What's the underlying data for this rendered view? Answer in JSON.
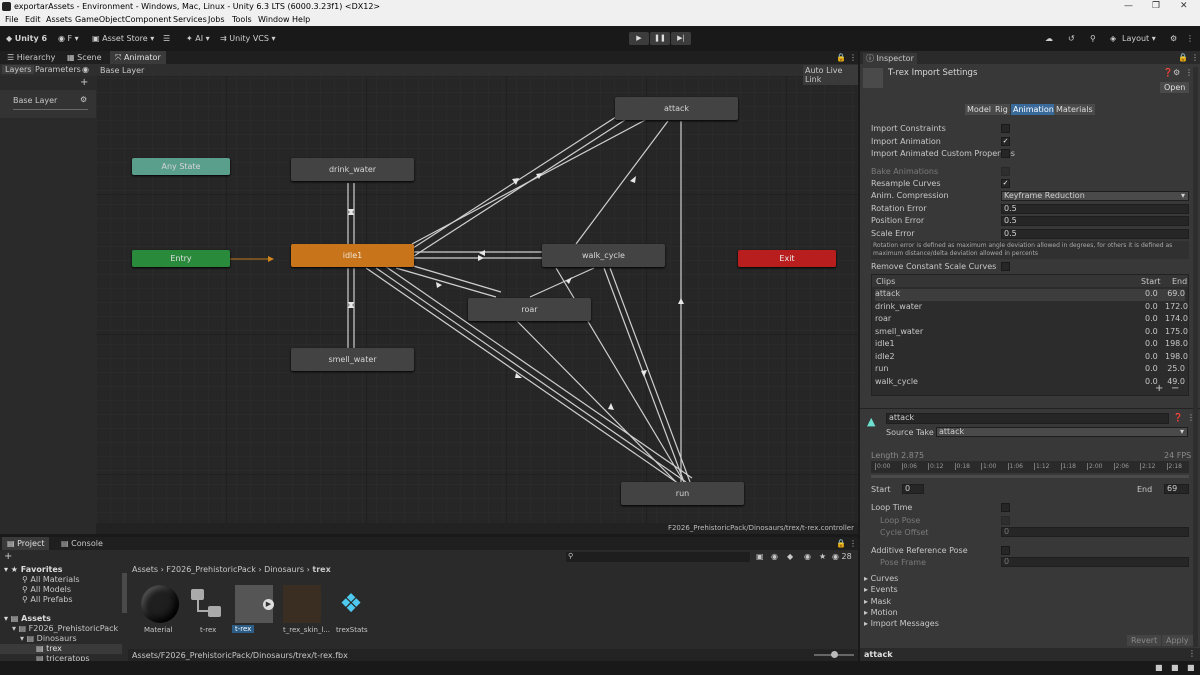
{
  "window": {
    "title": "exportarAssets - Environment - Windows, Mac, Linux - Unity 6.3 LTS (6000.3.23f1) <DX12>"
  },
  "menu": [
    "File",
    "Edit",
    "Assets",
    "GameObject",
    "Component",
    "Services",
    "Jobs",
    "Tools",
    "Window",
    "Help"
  ],
  "toolbar": {
    "unity": "Unity 6",
    "account": "F",
    "asset_store": "Asset Store",
    "ai": "AI",
    "vcs": "Unity VCS",
    "layout": "Layout"
  },
  "tabs": {
    "hierarchy": "Hierarchy",
    "scene": "Scene",
    "animator": "Animator",
    "inspector": "Inspector",
    "project": "Project",
    "console": "Console"
  },
  "animator": {
    "layers_tab": "Layers",
    "parameters_tab": "Parameters",
    "breadcrumb": "Base Layer",
    "auto_live": "Auto Live Link",
    "layer_name": "Base Layer",
    "path": "F2026_PrehistoricPack/Dinosaurs/trex/t-rex.controller",
    "states": {
      "any": "Any State",
      "entry": "Entry",
      "exit": "Exit",
      "attack": "attack",
      "drink": "drink_water",
      "idle": "idle1",
      "walk": "walk_cycle",
      "roar": "roar",
      "smell": "smell_water",
      "run": "run"
    }
  },
  "inspector": {
    "title": "T-rex Import Settings",
    "open": "Open",
    "tabs": [
      "Model",
      "Rig",
      "Animation",
      "Materials"
    ],
    "import_constraints": "Import Constraints",
    "import_animation": "Import Animation",
    "import_custom": "Import Animated Custom Properties",
    "bake": "Bake Animations",
    "resample": "Resample Curves",
    "compression_label": "Anim. Compression",
    "compression": "Keyframe Reduction",
    "rotation_error": "Rotation Error",
    "rotation_val": "0.5",
    "position_error": "Position Error",
    "position_val": "0.5",
    "scale_error": "Scale Error",
    "scale_val": "0.5",
    "help": "Rotation error is defined as maximum angle deviation allowed in degrees, for others it is defined as maximum distance/delta deviation allowed in percents",
    "remove_constant": "Remove Constant Scale Curves",
    "clips_header": {
      "name": "Clips",
      "start": "Start",
      "end": "End"
    },
    "clips": [
      {
        "n": "attack",
        "s": "0.0",
        "e": "69.0"
      },
      {
        "n": "drink_water",
        "s": "0.0",
        "e": "172.0"
      },
      {
        "n": "roar",
        "s": "0.0",
        "e": "174.0"
      },
      {
        "n": "smell_water",
        "s": "0.0",
        "e": "175.0"
      },
      {
        "n": "idle1",
        "s": "0.0",
        "e": "198.0"
      },
      {
        "n": "idle2",
        "s": "0.0",
        "e": "198.0"
      },
      {
        "n": "run",
        "s": "0.0",
        "e": "25.0"
      },
      {
        "n": "walk_cycle",
        "s": "0.0",
        "e": "49.0"
      }
    ],
    "clip_name": "attack",
    "source_take_label": "Source Take",
    "source_take": "attack",
    "length": "Length  2.875",
    "fps": "24 FPS",
    "timeline": [
      "0:00",
      "0:06",
      "0:12",
      "0:18",
      "1:00",
      "1:06",
      "1:12",
      "1:18",
      "2:00",
      "2:06",
      "2:12",
      "2:18"
    ],
    "start_label": "Start",
    "start_val": "0",
    "end_label": "End",
    "end_val": "69",
    "loop_time": "Loop Time",
    "loop_pose": "Loop Pose",
    "cycle_offset": "Cycle Offset",
    "cycle_val": "0",
    "additive": "Additive Reference Pose",
    "pose_frame": "Pose Frame",
    "pose_val": "0",
    "sections": [
      "Curves",
      "Events",
      "Mask",
      "Motion",
      "Import Messages"
    ],
    "revert": "Revert",
    "apply": "Apply",
    "preview": "attack"
  },
  "project": {
    "favorites": "Favorites",
    "fav_items": [
      "All Materials",
      "All Models",
      "All Prefabs"
    ],
    "assets": "Assets",
    "tree": [
      "F2026_PrehistoricPack",
      "Dinosaurs",
      "trex",
      "triceratops"
    ],
    "breadcrumb": [
      "Assets",
      "F2026_PrehistoricPack",
      "Dinosaurs",
      "trex"
    ],
    "items": [
      "Material",
      "t-rex",
      "t-rex",
      "t_rex_skin_l...",
      "trexStats"
    ],
    "path": "Assets/F2026_PrehistoricPack/Dinosaurs/trex/t-rex.fbx",
    "count": "28"
  }
}
